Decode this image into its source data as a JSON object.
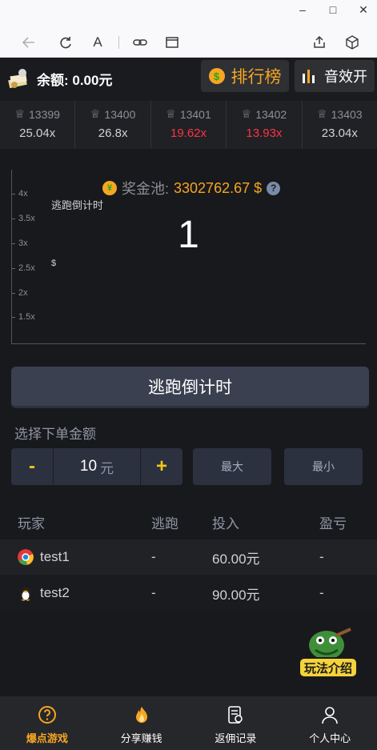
{
  "window": {
    "minimize": "–",
    "maximize": "□",
    "close": "✕"
  },
  "toolbar": {
    "reader_glyph": "A"
  },
  "header": {
    "balance_label": "余额: 0.00元",
    "rank_label": "排行榜",
    "sound_label": "音效开"
  },
  "history": [
    {
      "id": "13399",
      "mult": "25.04x",
      "color": "normal"
    },
    {
      "id": "13400",
      "mult": "26.8x",
      "color": "normal"
    },
    {
      "id": "13401",
      "mult": "19.62x",
      "color": "red"
    },
    {
      "id": "13402",
      "mult": "13.93x",
      "color": "red"
    },
    {
      "id": "13403",
      "mult": "23.04x",
      "color": "normal"
    }
  ],
  "game": {
    "pool_label": "奖金池:",
    "pool_value": "3302762.67 $",
    "help": "?",
    "countdown_small": "逃跑倒计时",
    "countdown_value": "1",
    "currency_mark": "$",
    "y_ticks": [
      "4x",
      "3.5x",
      "3x",
      "2.5x",
      "2x",
      "1.5x"
    ]
  },
  "actions": {
    "main_button": "逃跑倒计时",
    "amount_title": "选择下单金额",
    "minus": "-",
    "plus": "+",
    "amount": "10",
    "unit": "元",
    "max": "最大",
    "min": "最小"
  },
  "table": {
    "headers": [
      "玩家",
      "逃跑",
      "投入",
      "盈亏"
    ],
    "rows": [
      {
        "player": "test1",
        "escape": "-",
        "bet": "60.00元",
        "profit": "-"
      },
      {
        "player": "test2",
        "escape": "-",
        "bet": "90.00元",
        "profit": "-"
      }
    ]
  },
  "guide_label": "玩法介绍",
  "nav": [
    {
      "label": "爆点游戏",
      "active": true
    },
    {
      "label": "分享赚钱",
      "active": false
    },
    {
      "label": "返佣记录",
      "active": false
    },
    {
      "label": "个人中心",
      "active": false
    }
  ],
  "colors": {
    "accent": "#f5a623",
    "loss": "#ff3344",
    "panel": "#2c3140"
  }
}
